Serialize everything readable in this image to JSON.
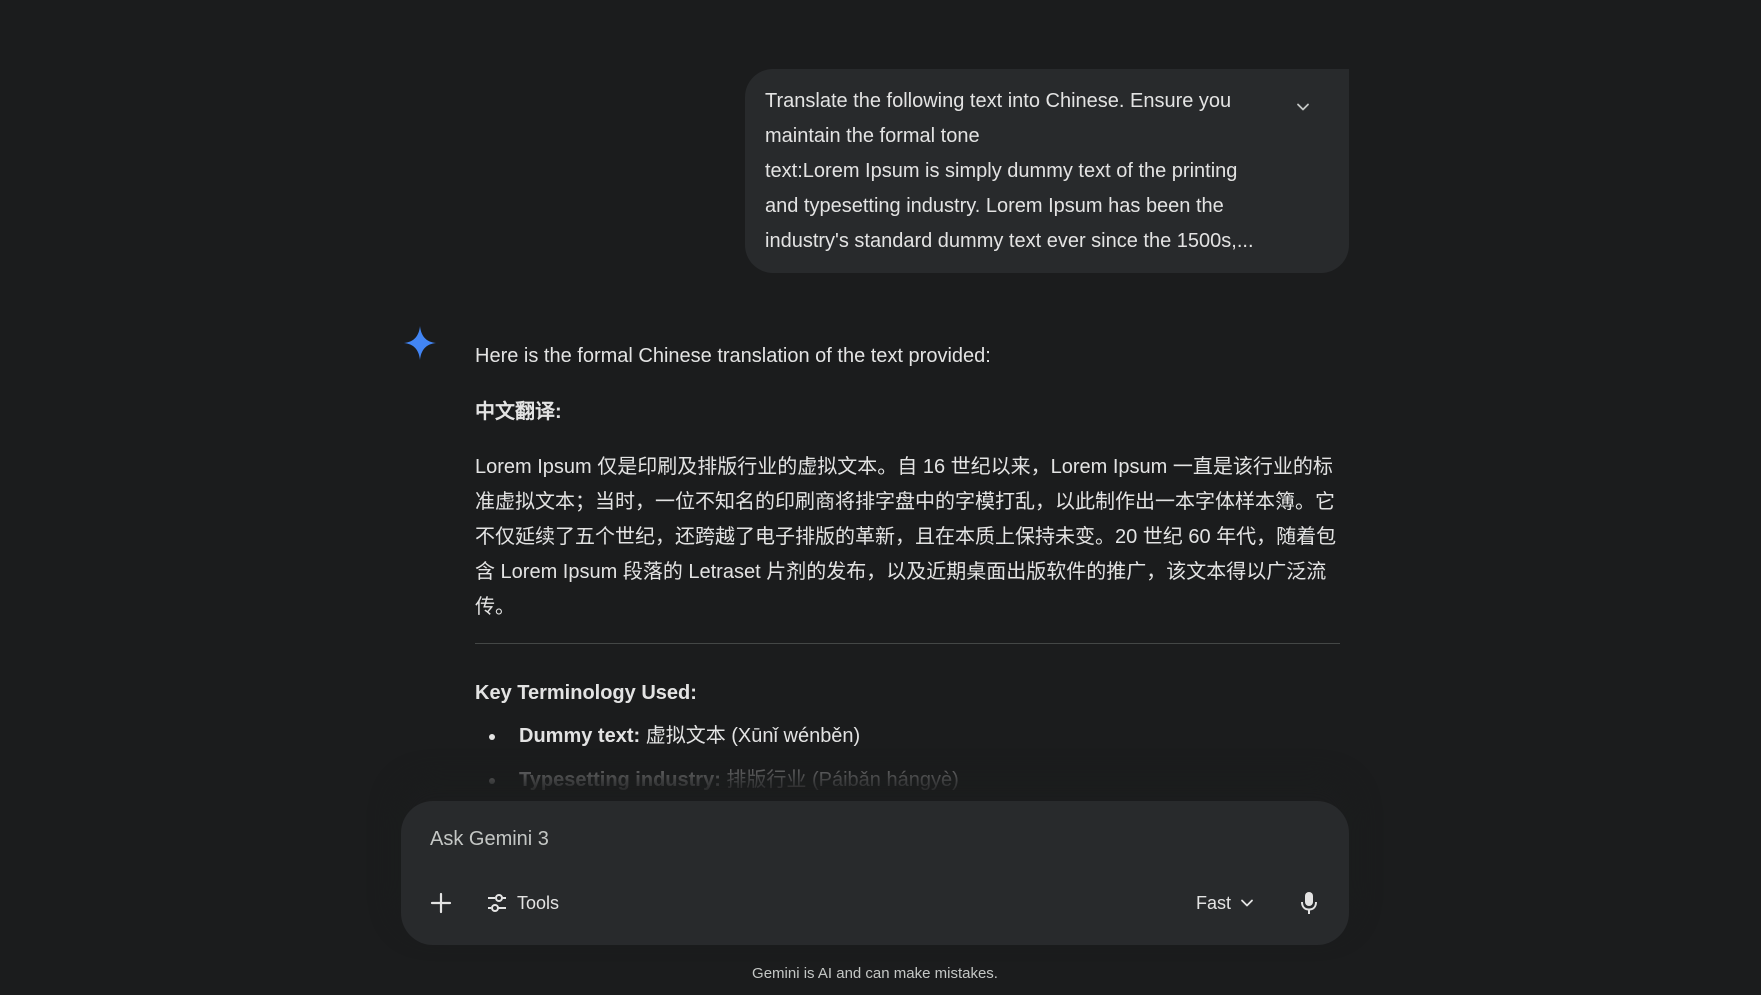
{
  "user_prompt": {
    "text": "Translate the following text into Chinese. Ensure you\nmaintain the formal tone\ntext:Lorem Ipsum is simply dummy text of the printing\nand typesetting industry. Lorem Ipsum has been the\nindustry's standard dummy text ever since the 1500s,...",
    "expand_icon": "chevron-down-icon"
  },
  "response": {
    "intro": "Here is the formal Chinese translation of the text provided:",
    "heading": "中文翻译:",
    "body": "Lorem Ipsum 仅是印刷及排版行业的虚拟文本。自 16 世纪以来，Lorem Ipsum 一直是该行业的标准虚拟文本；当时，一位不知名的印刷商将排字盘中的字模打乱，以此制作出一本字体样本簿。它不仅延续了五个世纪，还跨越了电子排版的革新，且在本质上保持未变。20 世纪 60 年代，随着包含 Lorem Ipsum 段落的 Letraset 片剂的发布，以及近期桌面出版软件的推广，该文本得以广泛流传。",
    "key_title": "Key Terminology Used:",
    "terms": [
      {
        "term": "Dummy text:",
        "translation": " 虚拟文本 (Xūnǐ wénběn)"
      },
      {
        "term": "Typesetting industry:",
        "translation": " 排版行业 (Páibǎn hángyè)"
      }
    ]
  },
  "input": {
    "placeholder": "Ask Gemini 3",
    "tools_label": "Tools",
    "mode_label": "Fast"
  },
  "disclaimer": "Gemini is AI and can make mistakes.",
  "colors": {
    "background": "#1b1c1d",
    "surface": "#282a2c",
    "text": "#e3e3e3",
    "spark_blue": "#4285f4"
  }
}
